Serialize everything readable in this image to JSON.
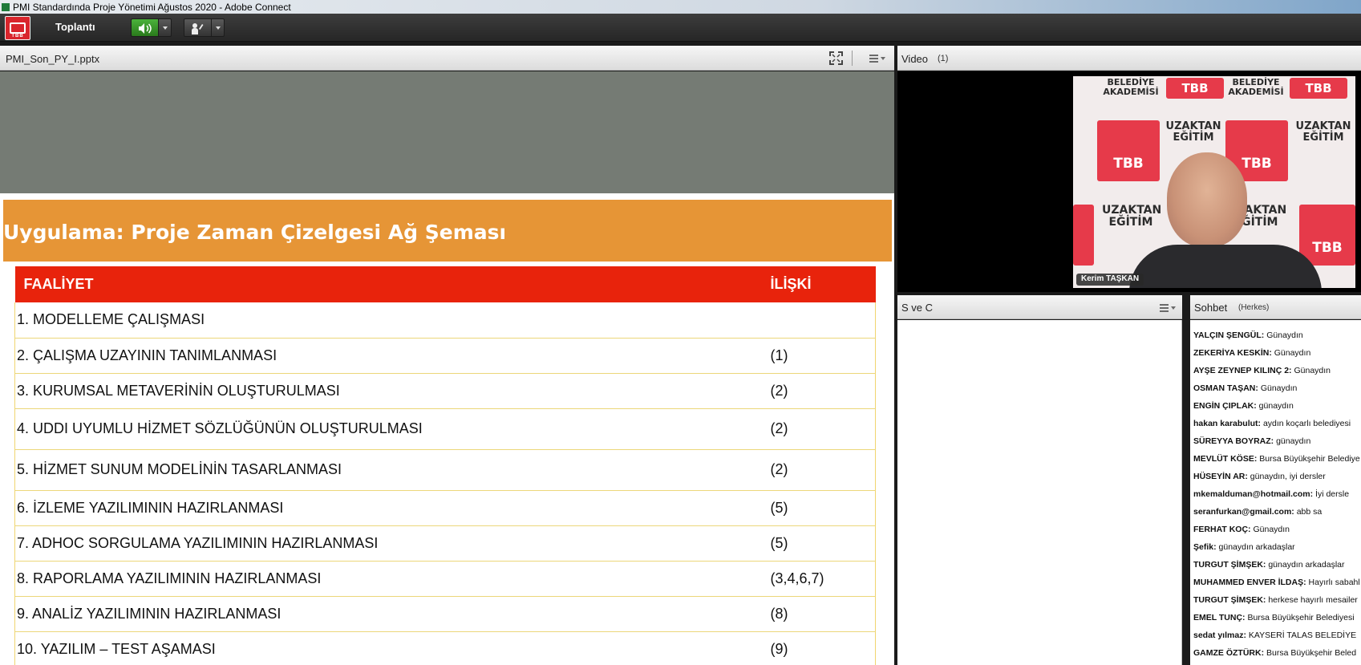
{
  "window": {
    "title": "PMI Standardında Proje Yönetimi Ağustos 2020 - Adobe Connect"
  },
  "menubar": {
    "logo_text": "TBB",
    "meeting_menu": "Toplantı"
  },
  "share_pod": {
    "file_name": "PMI_Son_PY_I.pptx"
  },
  "slide": {
    "title": "Uygulama: Proje Zaman Çizelgesi Ağ Şeması",
    "headers": {
      "activity": "FAALİYET",
      "relation": "İLİŞKİ"
    },
    "rows": [
      {
        "activity": "1. MODELLEME ÇALIŞMASI",
        "relation": ""
      },
      {
        "activity": "2. ÇALIŞMA UZAYININ TANIMLANMASI",
        "relation": "(1)"
      },
      {
        "activity": "3. KURUMSAL METAVERİNİN OLUŞTURULMASI",
        "relation": "(2)"
      },
      {
        "activity": "4. UDDI UYUMLU HİZMET SÖZLÜĞÜNÜN OLUŞTURULMASI",
        "relation": "(2)"
      },
      {
        "activity": "5. HİZMET SUNUM MODELİNİN TASARLANMASI",
        "relation": "(2)"
      },
      {
        "activity": "6. İZLEME YAZILIMININ HAZIRLANMASI",
        "relation": "(5)"
      },
      {
        "activity": "7. ADHOC SORGULAMA YAZILIMININ HAZIRLANMASI",
        "relation": "(5)"
      },
      {
        "activity": "8. RAPORLAMA YAZILIMININ HAZIRLANMASI",
        "relation": "(3,4,6,7)"
      },
      {
        "activity": "9. ANALİZ YAZILIMININ HAZIRLANMASI",
        "relation": "(8)"
      },
      {
        "activity": "10. YAZILIM – TEST AŞAMASI",
        "relation": "(9)"
      }
    ]
  },
  "video_pod": {
    "title": "Video",
    "count": "(1)",
    "presenter_name": "Kerim TAŞKAN",
    "background_texts": {
      "belediye_akademisi": "BELEDİYE AKADEMİSİ",
      "uzaktan_egitim": "UZAKTAN EĞİTİM",
      "tbb": "TBB"
    }
  },
  "qa_pod": {
    "title": "S ve C"
  },
  "chat_pod": {
    "title": "Sohbet",
    "audience": "(Herkes)",
    "messages": [
      {
        "sender": "YALÇIN ŞENGÜL:",
        "text": "Günaydın"
      },
      {
        "sender": "ZEKERİYA KESKİN:",
        "text": "Günaydın"
      },
      {
        "sender": "AYŞE ZEYNEP KILINÇ 2:",
        "text": "Günaydın"
      },
      {
        "sender": "OSMAN TAŞAN:",
        "text": "Günaydın"
      },
      {
        "sender": "ENGİN ÇIPLAK:",
        "text": "günaydın"
      },
      {
        "sender": "hakan karabulut:",
        "text": "aydın koçarlı belediyesi"
      },
      {
        "sender": "SÜREYYA BOYRAZ:",
        "text": "günaydın"
      },
      {
        "sender": "MEVLÜT KÖSE:",
        "text": "Bursa Büyükşehir Belediye"
      },
      {
        "sender": "HÜSEYİN AR:",
        "text": "günaydın, iyi dersler"
      },
      {
        "sender": "mkemalduman@hotmail.com:",
        "text": "İyi dersle"
      },
      {
        "sender": "seranfurkan@gmail.com:",
        "text": "abb sa"
      },
      {
        "sender": "FERHAT KOÇ:",
        "text": "Günaydın"
      },
      {
        "sender": "Şefik:",
        "text": "günaydın arkadaşlar"
      },
      {
        "sender": "TURGUT ŞİMŞEK:",
        "text": "günaydın arkadaşlar"
      },
      {
        "sender": "MUHAMMED ENVER İLDAŞ:",
        "text": "Hayırlı sabahl"
      },
      {
        "sender": "TURGUT ŞİMŞEK:",
        "text": "herkese hayırlı mesailer"
      },
      {
        "sender": "EMEL TUNÇ:",
        "text": "Bursa Büyükşehir Belediyesi"
      },
      {
        "sender": "sedat yılmaz:",
        "text": "KAYSERİ TALAS BELEDİYE"
      },
      {
        "sender": "GAMZE ÖZTÜRK:",
        "text": "Bursa Büyükşehir Beled"
      }
    ]
  },
  "colors": {
    "slide_banner": "#e69536",
    "table_header": "#e8230c",
    "table_border": "#f1d56f",
    "speaker_active": "#3a9a2c"
  }
}
